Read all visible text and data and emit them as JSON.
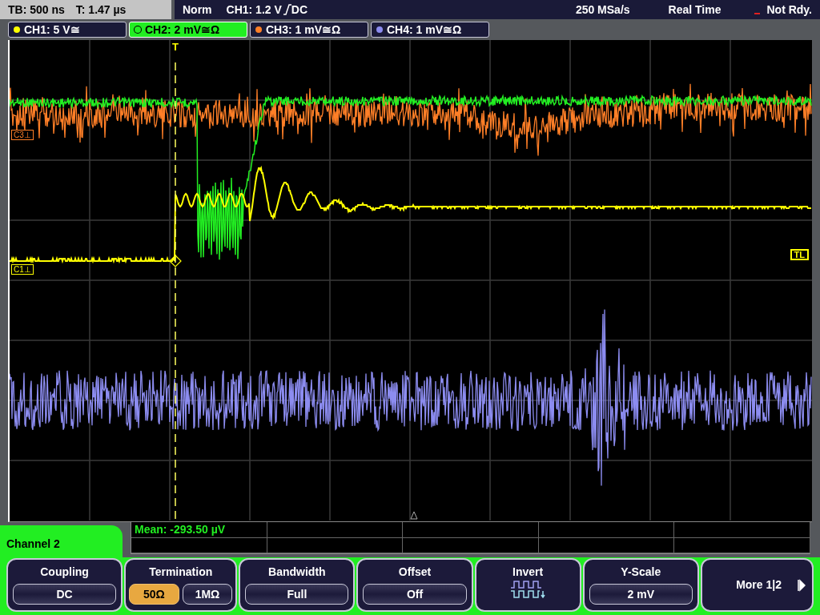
{
  "status_bar": {
    "timebase": "TB: 500 ns",
    "trigger_time": "T: 1.47 µs",
    "mode": "Norm",
    "trigger_level": "CH1: 1.2 V",
    "trigger_coupling": "DC",
    "sample_rate": "250 MSa/s",
    "acquisition": "Real Time",
    "state": "Not Rdy."
  },
  "channels": [
    {
      "label": "CH1: 5 V≅",
      "color": "#ffff00",
      "selected": false
    },
    {
      "label": "CH2: 2 mV≅Ω",
      "color": "#22ee22",
      "selected": true
    },
    {
      "label": "CH3: 1 mV≅Ω",
      "color": "#ff7f27",
      "selected": false
    },
    {
      "label": "CH4: 1 mV≅Ω",
      "color": "#8c8cf0",
      "selected": false
    }
  ],
  "scope": {
    "trigger_marker": "T",
    "markers": [
      {
        "label": "C3⊥",
        "color": "#ff7f27"
      },
      {
        "label": "C1⊥",
        "color": "#ffff00"
      }
    ],
    "trigger_level_marker": "TL"
  },
  "measurement": "Mean: -293.50 µV",
  "menu": {
    "title": "Channel 2",
    "buttons": [
      {
        "kind": "value",
        "label": "Coupling",
        "value": "DC"
      },
      {
        "kind": "toggle",
        "label": "Termination",
        "options": [
          {
            "label": "50Ω",
            "selected": true
          },
          {
            "label": "1MΩ",
            "selected": false
          }
        ]
      },
      {
        "kind": "value",
        "label": "Bandwidth",
        "value": "Full"
      },
      {
        "kind": "value",
        "label": "Offset",
        "value": "Off"
      },
      {
        "kind": "icon",
        "label": "Invert"
      },
      {
        "kind": "value",
        "label": "Y-Scale",
        "value": "2 mV"
      },
      {
        "kind": "more",
        "label": "More 1|2"
      }
    ]
  }
}
